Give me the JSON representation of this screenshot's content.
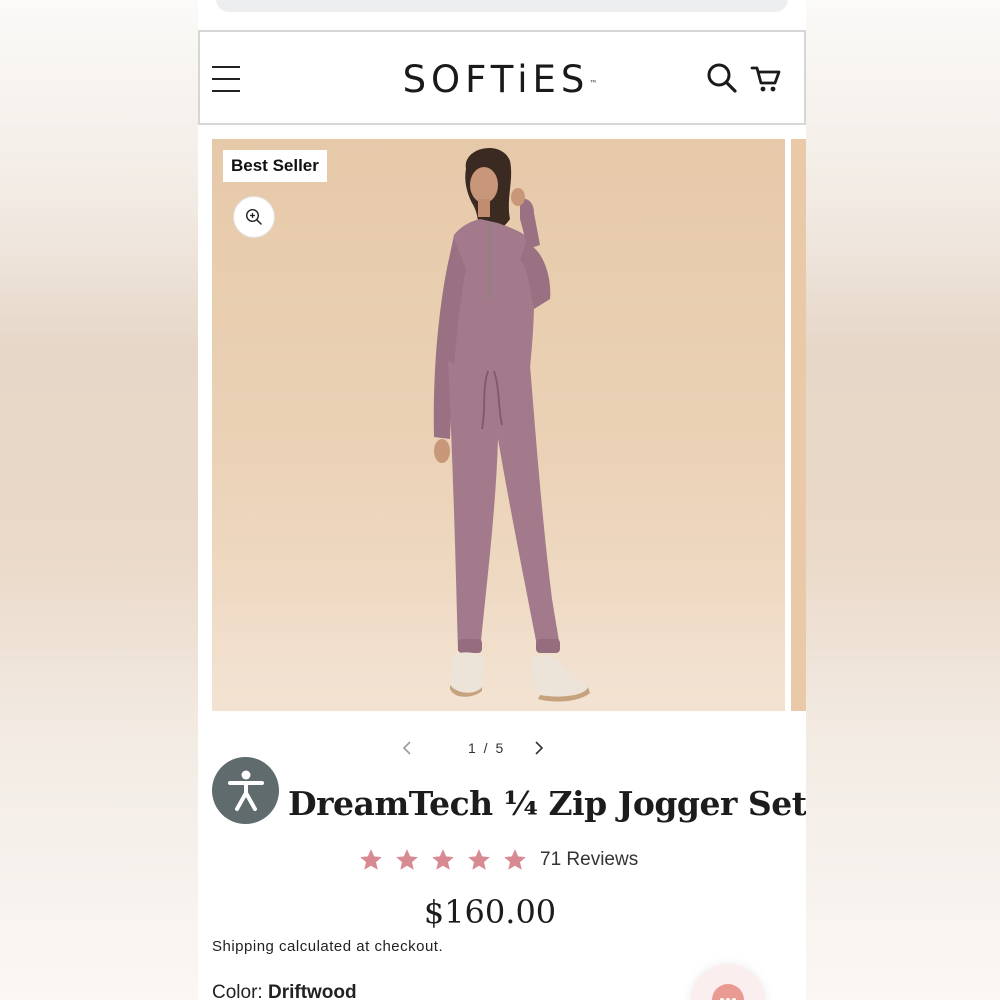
{
  "header": {
    "logo_text": "SOFTiES",
    "logo_mark": "™",
    "icons": [
      "menu-icon",
      "search-icon",
      "cart-icon"
    ]
  },
  "gallery": {
    "badge": "Best Seller",
    "pager": "1 / 5",
    "current_index": 1,
    "total": 5,
    "background_color": "#e8cdb0",
    "garment_color": "#a27a8b"
  },
  "product": {
    "title": "DreamTech ¼ Zip Jogger Set",
    "rating": 5,
    "star_color": "#d88a92",
    "reviews": "71 Reviews",
    "price": "$160.00",
    "shipping": "Shipping calculated at checkout.",
    "color_label": "Color:",
    "color_value": "Driftwood"
  },
  "accessibility": {
    "icon": "accessibility-icon",
    "color": "#5f6b6d"
  },
  "chat": {
    "icon": "chat-icon",
    "color": "#e89a93"
  }
}
